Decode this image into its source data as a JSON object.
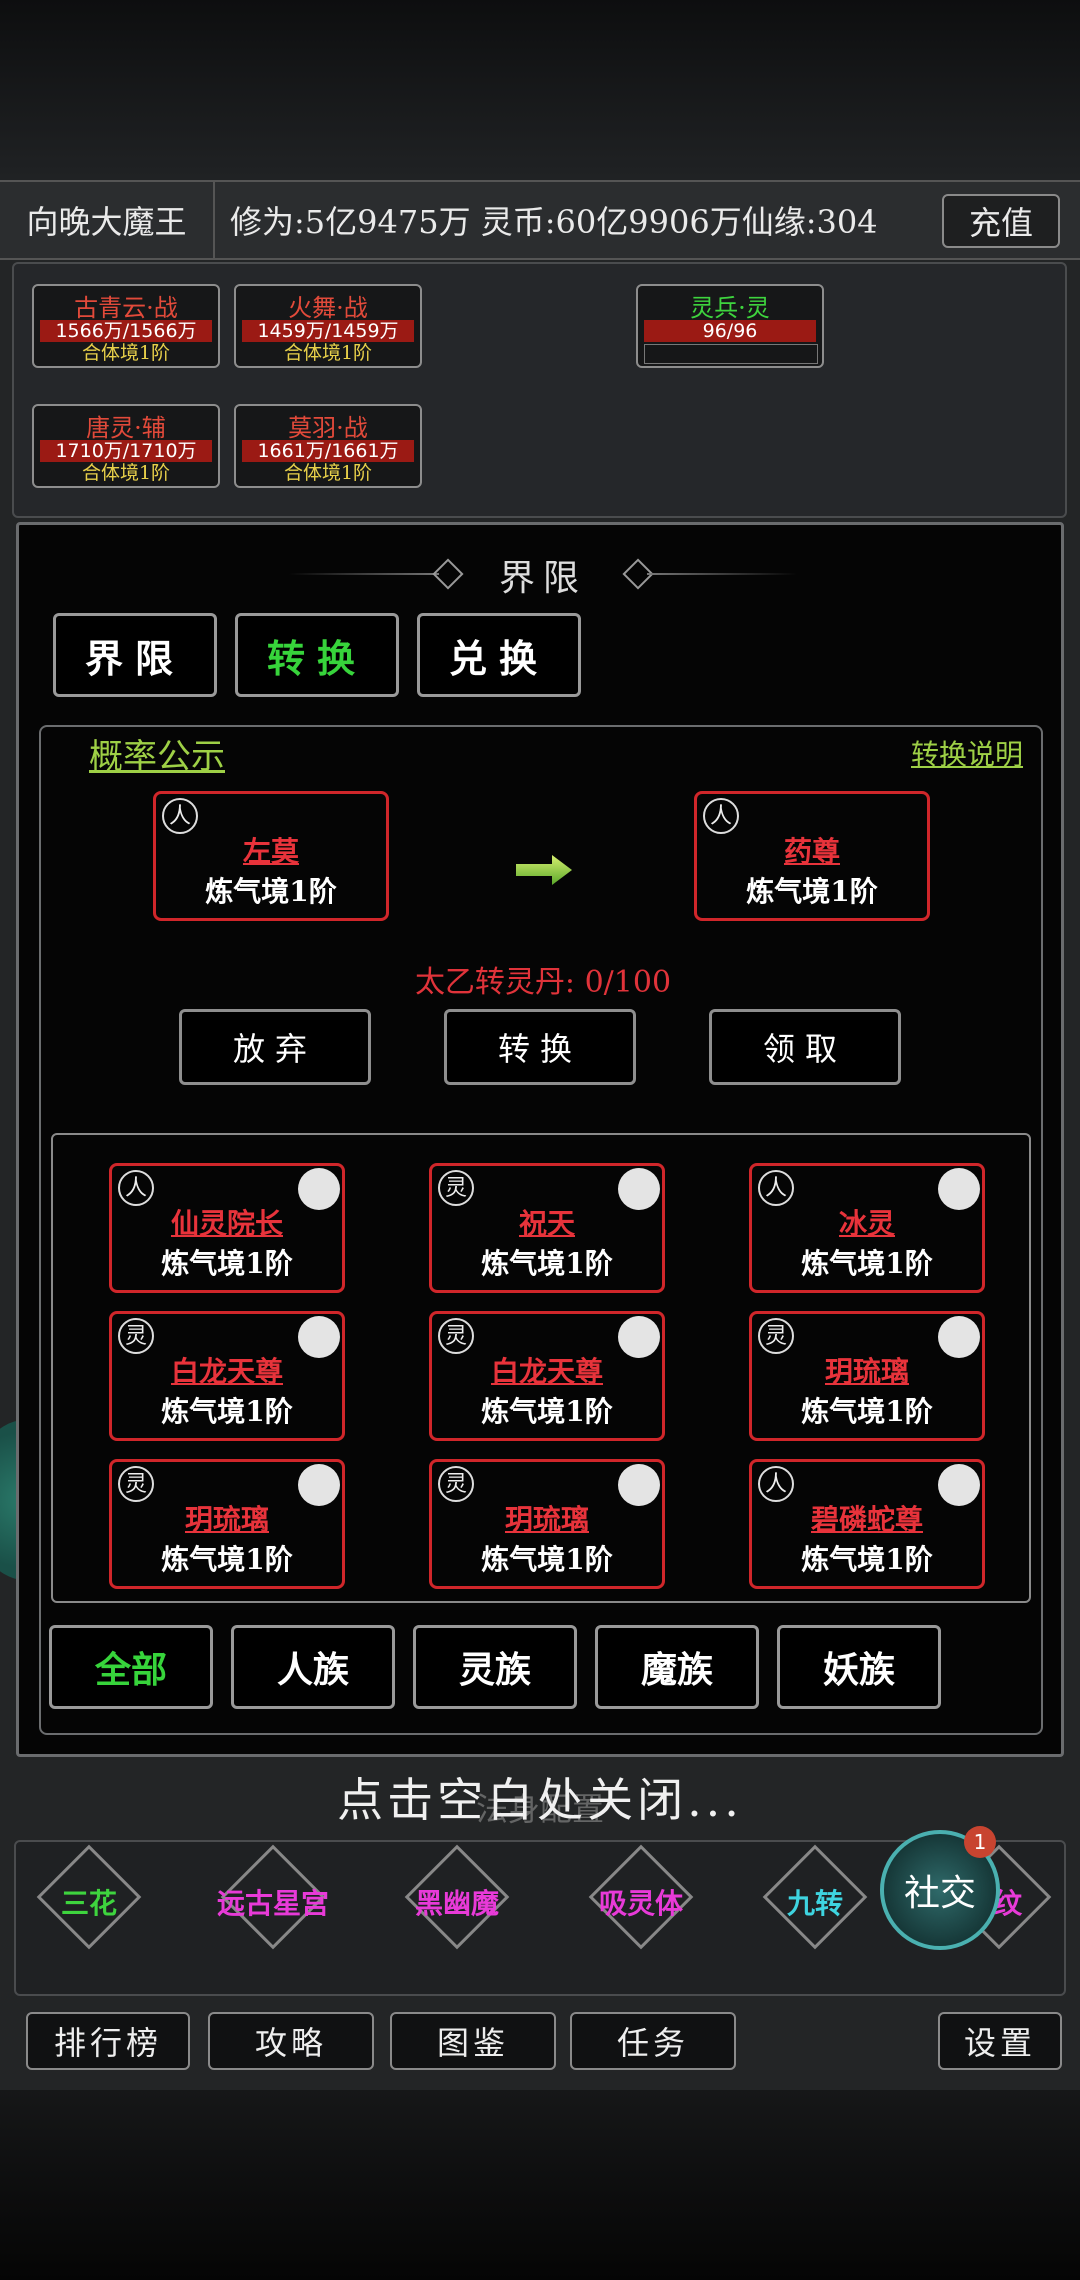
{
  "header": {
    "player_name": "向晚大魔王",
    "stats": "修为:5亿9475万 灵币:60亿9906万仙缘:304",
    "recharge_label": "充值"
  },
  "team": [
    {
      "name": "古青云·战",
      "hp": "1566万/1566万",
      "realm": "合体境1阶"
    },
    {
      "name": "火舞·战",
      "hp": "1459万/1459万",
      "realm": "合体境1阶"
    },
    {
      "name": "灵兵·灵",
      "hp": "96/96",
      "realm": ""
    },
    {
      "name": "唐灵·辅",
      "hp": "1710万/1710万",
      "realm": "合体境1阶"
    },
    {
      "name": "莫羽·战",
      "hp": "1661万/1661万",
      "realm": "合体境1阶"
    }
  ],
  "modal": {
    "title": "界限",
    "tabs": [
      "界限",
      "转换",
      "兑换"
    ],
    "active_tab": "转换",
    "probability_link": "概率公示",
    "help_link": "转换说明",
    "source": {
      "race": "人",
      "name": "左莫",
      "realm": "炼气境1阶"
    },
    "target": {
      "race": "人",
      "name": "药尊",
      "realm": "炼气境1阶"
    },
    "pill_text": "太乙转灵丹: 0/100",
    "actions": [
      "放弃",
      "转换",
      "领取"
    ],
    "grid": [
      {
        "race": "人",
        "name": "仙灵院长",
        "realm": "炼气境1阶"
      },
      {
        "race": "灵",
        "name": "祝天",
        "realm": "炼气境1阶"
      },
      {
        "race": "人",
        "name": "冰灵",
        "realm": "炼气境1阶"
      },
      {
        "race": "灵",
        "name": "白龙天尊",
        "realm": "炼气境1阶"
      },
      {
        "race": "灵",
        "name": "白龙天尊",
        "realm": "炼气境1阶"
      },
      {
        "race": "灵",
        "name": "玥琉璃",
        "realm": "炼气境1阶"
      },
      {
        "race": "灵",
        "name": "玥琉璃",
        "realm": "炼气境1阶"
      },
      {
        "race": "灵",
        "name": "玥琉璃",
        "realm": "炼气境1阶"
      },
      {
        "race": "人",
        "name": "碧磷蛇尊",
        "realm": "炼气境1阶"
      }
    ],
    "filters": [
      "全部",
      "人族",
      "灵族",
      "魔族",
      "妖族"
    ],
    "active_filter": "全部"
  },
  "close_hint": "点击空白处关闭...",
  "nav": {
    "items": [
      {
        "label": "三花",
        "color": "#3ed43e"
      },
      {
        "label": "远古星宫",
        "color": "#e83ad8"
      },
      {
        "label": "黑幽魔",
        "color": "#e83ad8"
      },
      {
        "label": "吸灵体",
        "color": "#e83ad8"
      },
      {
        "label": "九转",
        "color": "#3ed4e0"
      },
      {
        "label": "圣纹",
        "color": "#e83ad8"
      }
    ],
    "social_label": "社交",
    "social_badge": "1"
  },
  "bottom_buttons": [
    "排行榜",
    "攻略",
    "图鉴",
    "任务",
    "设置"
  ],
  "ghost_text": "法身配置"
}
